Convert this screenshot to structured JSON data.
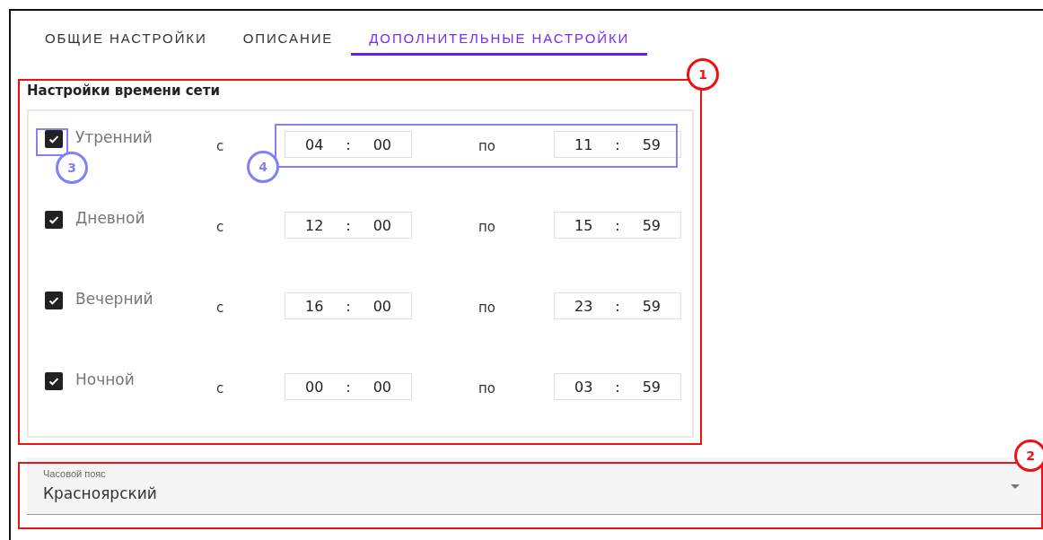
{
  "tabs": [
    {
      "label": "ОБЩИЕ НАСТРОЙКИ",
      "selected": false
    },
    {
      "label": "ОПИСАНИЕ",
      "selected": false
    },
    {
      "label": "ДОПОЛНИТЕЛЬНЫЕ НАСТРОЙКИ",
      "selected": true
    }
  ],
  "network_time": {
    "title": "Настройки времени сети",
    "rows": [
      {
        "label": "Утренний",
        "checked": true,
        "from_label": "с",
        "from": {
          "hours": "04",
          "separator": ":",
          "minutes": "00"
        },
        "to_label": "по",
        "to": {
          "hours": "11",
          "separator": ":",
          "minutes": "59"
        }
      },
      {
        "label": "Дневной",
        "checked": true,
        "from_label": "с",
        "from": {
          "hours": "12",
          "separator": ":",
          "minutes": "00"
        },
        "to_label": "по",
        "to": {
          "hours": "15",
          "separator": ":",
          "minutes": "59"
        }
      },
      {
        "label": "Вечерний",
        "checked": true,
        "from_label": "с",
        "from": {
          "hours": "16",
          "separator": ":",
          "minutes": "00"
        },
        "to_label": "по",
        "to": {
          "hours": "23",
          "separator": ":",
          "minutes": "59"
        }
      },
      {
        "label": "Ночной",
        "checked": true,
        "from_label": "с",
        "from": {
          "hours": "00",
          "separator": ":",
          "minutes": "00"
        },
        "to_label": "по",
        "to": {
          "hours": "03",
          "separator": ":",
          "minutes": "59"
        }
      }
    ]
  },
  "timezone": {
    "label": "Часовой пояс",
    "value": "Красноярский"
  },
  "annotations": [
    {
      "number": "1",
      "color": "#ee1111"
    },
    {
      "number": "2",
      "color": "#ee1111"
    },
    {
      "number": "3",
      "color": "#8080f8"
    },
    {
      "number": "4",
      "color": "#8080f8"
    }
  ]
}
